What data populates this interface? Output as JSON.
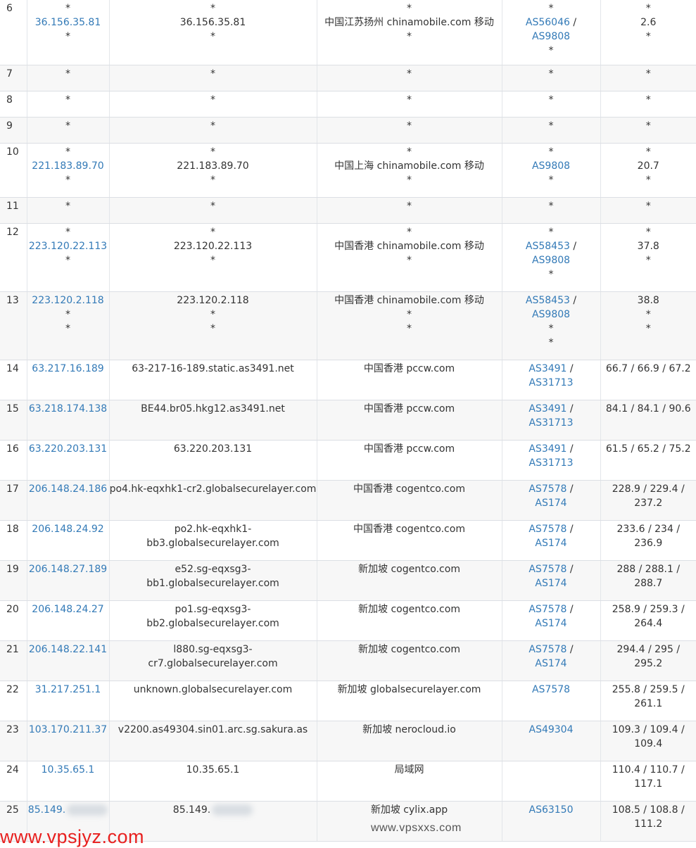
{
  "rows": [
    {
      "hop": "6",
      "ip": [
        "*",
        "36.156.35.81",
        "*"
      ],
      "host": [
        "*",
        "36.156.35.81",
        "*"
      ],
      "location": [
        "*",
        "中国江苏扬州 chinamobile.com 移动",
        "*"
      ],
      "as": [
        [
          "*"
        ],
        [
          "AS56046",
          "AS9808"
        ],
        [
          "*"
        ]
      ],
      "rtt": [
        "*",
        "2.6",
        "*"
      ]
    },
    {
      "hop": "7",
      "ip": [
        "*"
      ],
      "host": [
        "*"
      ],
      "location": [
        "*"
      ],
      "as": [
        [
          "*"
        ]
      ],
      "rtt": [
        "*"
      ]
    },
    {
      "hop": "8",
      "ip": [
        "*"
      ],
      "host": [
        "*"
      ],
      "location": [
        "*"
      ],
      "as": [
        [
          "*"
        ]
      ],
      "rtt": [
        "*"
      ]
    },
    {
      "hop": "9",
      "ip": [
        "*"
      ],
      "host": [
        "*"
      ],
      "location": [
        "*"
      ],
      "as": [
        [
          "*"
        ]
      ],
      "rtt": [
        "*"
      ]
    },
    {
      "hop": "10",
      "ip": [
        "*",
        "221.183.89.70",
        "*"
      ],
      "host": [
        "*",
        "221.183.89.70",
        "*"
      ],
      "location": [
        "*",
        "中国上海 chinamobile.com 移动",
        "*"
      ],
      "as": [
        [
          "*"
        ],
        [
          "AS9808"
        ],
        [
          "*"
        ]
      ],
      "rtt": [
        "*",
        "20.7",
        "*"
      ]
    },
    {
      "hop": "11",
      "ip": [
        "*"
      ],
      "host": [
        "*"
      ],
      "location": [
        "*"
      ],
      "as": [
        [
          "*"
        ]
      ],
      "rtt": [
        "*"
      ]
    },
    {
      "hop": "12",
      "ip": [
        "*",
        "223.120.22.113",
        "*"
      ],
      "host": [
        "*",
        "223.120.22.113",
        "*"
      ],
      "location": [
        "*",
        "中国香港 chinamobile.com 移动",
        "*"
      ],
      "as": [
        [
          "*"
        ],
        [
          "AS58453",
          "AS9808"
        ],
        [
          "*"
        ]
      ],
      "rtt": [
        "*",
        "37.8",
        "*"
      ]
    },
    {
      "hop": "13",
      "ip": [
        "223.120.2.118",
        "*",
        "*"
      ],
      "host": [
        "223.120.2.118",
        "*",
        "*"
      ],
      "location": [
        "中国香港 chinamobile.com 移动",
        "*",
        "*"
      ],
      "as": [
        [
          "AS58453",
          "AS9808"
        ],
        [
          "*"
        ],
        [
          "*"
        ]
      ],
      "rtt": [
        "38.8",
        "*",
        "*"
      ]
    },
    {
      "hop": "14",
      "ip": [
        "63.217.16.189"
      ],
      "host": [
        "63-217-16-189.static.as3491.net"
      ],
      "location": [
        "中国香港 pccw.com"
      ],
      "as": [
        [
          "AS3491",
          "AS31713"
        ]
      ],
      "rtt": [
        "66.7 / 66.9 / 67.2"
      ]
    },
    {
      "hop": "15",
      "ip": [
        "63.218.174.138"
      ],
      "host": [
        "BE44.br05.hkg12.as3491.net"
      ],
      "location": [
        "中国香港 pccw.com"
      ],
      "as": [
        [
          "AS3491",
          "AS31713"
        ]
      ],
      "rtt": [
        "84.1 / 84.1 / 90.6"
      ]
    },
    {
      "hop": "16",
      "ip": [
        "63.220.203.131"
      ],
      "host": [
        "63.220.203.131"
      ],
      "location": [
        "中国香港 pccw.com"
      ],
      "as": [
        [
          "AS3491",
          "AS31713"
        ]
      ],
      "rtt": [
        "61.5 / 65.2 / 75.2"
      ]
    },
    {
      "hop": "17",
      "ip": [
        "206.148.24.186"
      ],
      "host": [
        "po4.hk-eqxhk1-cr2.globalsecurelayer.com"
      ],
      "location": [
        "中国香港 cogentco.com"
      ],
      "as": [
        [
          "AS7578",
          "AS174"
        ]
      ],
      "rtt": [
        "228.9 / 229.4 / 237.2"
      ]
    },
    {
      "hop": "18",
      "ip": [
        "206.148.24.92"
      ],
      "host": [
        "po2.hk-eqxhk1-bb3.globalsecurelayer.com"
      ],
      "location": [
        "中国香港 cogentco.com"
      ],
      "as": [
        [
          "AS7578",
          "AS174"
        ]
      ],
      "rtt": [
        "233.6 / 234 / 236.9"
      ]
    },
    {
      "hop": "19",
      "ip": [
        "206.148.27.189"
      ],
      "host": [
        "e52.sg-eqxsg3-bb1.globalsecurelayer.com"
      ],
      "location": [
        "新加坡 cogentco.com"
      ],
      "as": [
        [
          "AS7578",
          "AS174"
        ]
      ],
      "rtt": [
        "288 / 288.1 / 288.7"
      ]
    },
    {
      "hop": "20",
      "ip": [
        "206.148.24.27"
      ],
      "host": [
        "po1.sg-eqxsg3-bb2.globalsecurelayer.com"
      ],
      "location": [
        "新加坡 cogentco.com"
      ],
      "as": [
        [
          "AS7578",
          "AS174"
        ]
      ],
      "rtt": [
        "258.9 / 259.3 / 264.4"
      ]
    },
    {
      "hop": "21",
      "ip": [
        "206.148.22.141"
      ],
      "host": [
        "l880.sg-eqxsg3-cr7.globalsecurelayer.com"
      ],
      "location": [
        "新加坡 cogentco.com"
      ],
      "as": [
        [
          "AS7578",
          "AS174"
        ]
      ],
      "rtt": [
        "294.4 / 295 / 295.2"
      ]
    },
    {
      "hop": "22",
      "ip": [
        "31.217.251.1"
      ],
      "host": [
        "unknown.globalsecurelayer.com"
      ],
      "location": [
        "新加坡 globalsecurelayer.com"
      ],
      "as": [
        [
          "AS7578"
        ]
      ],
      "rtt": [
        "255.8 / 259.5 / 261.1"
      ]
    },
    {
      "hop": "23",
      "ip": [
        "103.170.211.37"
      ],
      "host": [
        "v2200.as49304.sin01.arc.sg.sakura.as"
      ],
      "location": [
        "新加坡 nerocloud.io"
      ],
      "as": [
        [
          "AS49304"
        ]
      ],
      "rtt": [
        "109.3 / 109.4 / 109.4"
      ]
    },
    {
      "hop": "24",
      "ip": [
        "10.35.65.1"
      ],
      "host": [
        "10.35.65.1"
      ],
      "location": [
        "局域网"
      ],
      "as": [
        []
      ],
      "rtt": [
        "110.4 / 110.7 / 117.1"
      ]
    },
    {
      "hop": "25",
      "ip": [
        "85.149."
      ],
      "host": [
        "85.149."
      ],
      "location": [
        "新加坡 cylix.app"
      ],
      "as": [
        [
          "AS63150"
        ]
      ],
      "rtt": [
        "108.5 / 108.8 / 111.2"
      ]
    }
  ],
  "watermarks": {
    "left": "www.vpsjyz.com",
    "center": "www.vpsxxs.com"
  },
  "colors": {
    "link": "#337ab7",
    "text": "#333333",
    "stripe": "#f7f7f7",
    "watermark_red": "#e8201f"
  }
}
